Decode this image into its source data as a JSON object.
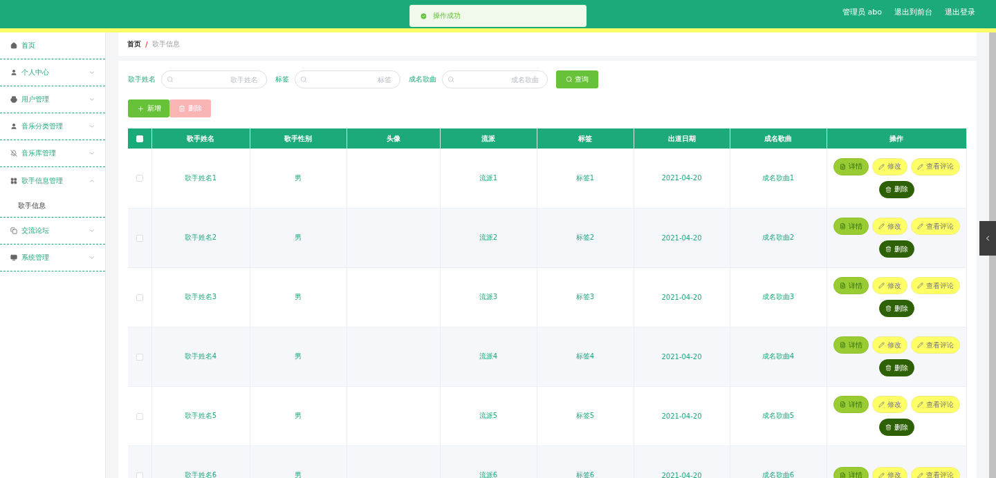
{
  "toast": {
    "message": "操作成功"
  },
  "header": {
    "links": [
      "管理员 abo",
      "退出到前台",
      "退出登录"
    ]
  },
  "sidebar": {
    "items": [
      {
        "label": "首页"
      },
      {
        "label": "个人中心",
        "expanded": false
      },
      {
        "label": "用户管理",
        "expanded": false
      },
      {
        "label": "音乐分类管理",
        "expanded": false
      },
      {
        "label": "音乐库管理",
        "expanded": false
      },
      {
        "label": "歌手信息管理",
        "expanded": true,
        "children": [
          {
            "label": "歌手信息"
          }
        ]
      },
      {
        "label": "交流论坛",
        "expanded": false
      },
      {
        "label": "系统管理",
        "expanded": false
      }
    ]
  },
  "breadcrumb": [
    "首页",
    "歌手信息"
  ],
  "breadcrumb_separator": "/",
  "search": [
    {
      "label": "歌手姓名",
      "placeholder": "歌手姓名"
    },
    {
      "label": "标签",
      "placeholder": "标签"
    },
    {
      "label": "成名歌曲",
      "placeholder": "成名歌曲"
    }
  ],
  "query_button": "查询",
  "toolbar": [
    {
      "kind": "add",
      "label": "新增",
      "disabled": false
    },
    {
      "kind": "delete",
      "label": "删除",
      "disabled": true
    }
  ],
  "table": {
    "select_all_checked": false,
    "columns": [
      "歌手姓名",
      "歌手性别",
      "头像",
      "流派",
      "标签",
      "出道日期",
      "成名歌曲",
      "操作"
    ],
    "rows": [
      {
        "checked": false,
        "cells": [
          "歌手姓名1",
          "男",
          "",
          "流派1",
          "标签1",
          "2021-04-20",
          "成名歌曲1"
        ],
        "actions": [
          {
            "kind": "detail",
            "label": "详情"
          },
          {
            "kind": "edit",
            "label": "修改"
          },
          {
            "kind": "comment",
            "label": "查看评论"
          },
          {
            "kind": "delete",
            "label": "删除"
          }
        ]
      },
      {
        "checked": false,
        "cells": [
          "歌手姓名2",
          "男",
          "",
          "流派2",
          "标签2",
          "2021-04-20",
          "成名歌曲2"
        ],
        "actions": [
          {
            "kind": "detail",
            "label": "详情"
          },
          {
            "kind": "edit",
            "label": "修改"
          },
          {
            "kind": "comment",
            "label": "查看评论"
          },
          {
            "kind": "delete",
            "label": "删除"
          }
        ]
      },
      {
        "checked": false,
        "cells": [
          "歌手姓名3",
          "男",
          "",
          "流派3",
          "标签3",
          "2021-04-20",
          "成名歌曲3"
        ],
        "actions": [
          {
            "kind": "detail",
            "label": "详情"
          },
          {
            "kind": "edit",
            "label": "修改"
          },
          {
            "kind": "comment",
            "label": "查看评论"
          },
          {
            "kind": "delete",
            "label": "删除"
          }
        ]
      },
      {
        "checked": false,
        "cells": [
          "歌手姓名4",
          "男",
          "",
          "流派4",
          "标签4",
          "2021-04-20",
          "成名歌曲4"
        ],
        "actions": [
          {
            "kind": "detail",
            "label": "详情"
          },
          {
            "kind": "edit",
            "label": "修改"
          },
          {
            "kind": "comment",
            "label": "查看评论"
          },
          {
            "kind": "delete",
            "label": "删除"
          }
        ]
      },
      {
        "checked": false,
        "cells": [
          "歌手姓名5",
          "男",
          "",
          "流派5",
          "标签5",
          "2021-04-20",
          "成名歌曲5"
        ],
        "actions": [
          {
            "kind": "detail",
            "label": "详情"
          },
          {
            "kind": "edit",
            "label": "修改"
          },
          {
            "kind": "comment",
            "label": "查看评论"
          },
          {
            "kind": "delete",
            "label": "删除"
          }
        ]
      },
      {
        "checked": false,
        "cells": [
          "歌手姓名6",
          "男",
          "",
          "流派6",
          "标签6",
          "2021-04-20",
          "成名歌曲6"
        ],
        "actions": [
          {
            "kind": "detail",
            "label": "详情"
          },
          {
            "kind": "edit",
            "label": "修改"
          },
          {
            "kind": "comment",
            "label": "查看评论"
          }
        ]
      }
    ]
  }
}
